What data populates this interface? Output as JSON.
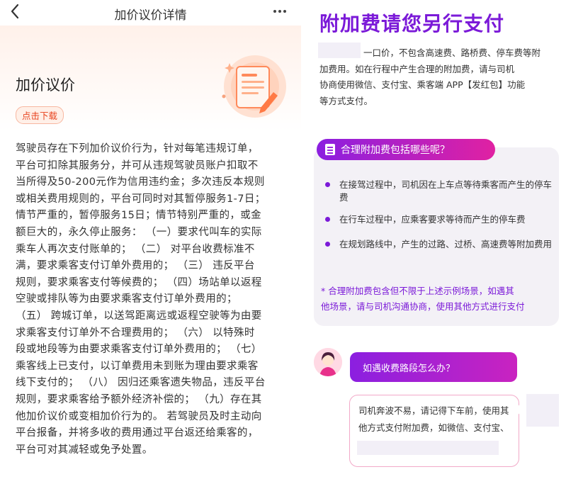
{
  "left": {
    "nav": {
      "back_icon": "chevron-left-icon",
      "title": "加价议价详情",
      "more_icon": "more-dots-icon"
    },
    "page_title": "加价议价",
    "download_label": "点击下载",
    "illustration_icon": "document-pen-icon",
    "rules_lines": [
      "驾驶员存在下列加价议价行为，针对每笔违规订单，",
      "平台可扣除其服务分，并可从违规驾驶员账户扣取不",
      "当所得及50-200元作为信用违约金；多次违反本规则",
      "或相关费用规则的，平台可同时对其暂停服务1-7日；",
      "情节严重的，暂停服务15日；情节特别严重的，或金",
      "额巨大的，永久停止服务：  （一）要求代叫车的实际",
      "乘车人再次支付账单的；  （二）  对平台收费标准不",
      "满，要求乘客支付订单外费用的；  （三）  违反平台",
      "规则，要求乘客支付等候费的；  （四）场站单以返程",
      "空驶或排队等为由要求乘客支付订单外费用的；",
      "（五）  跨城订单，以送驾距离远或返程空驶等为由要",
      "求乘客支付订单外不合理费用的；  （六）  以特殊时",
      "段或地段等为由要求乘客支付订单外费用的；  （七）",
      "乘客线上已支付，以订单费用未到账为理由要求乘客",
      "线下支付的；  （八）  因归还乘客遗失物品，违反平台",
      "规则，要求乘客给予额外经济补偿的；  （九）存在其",
      "他加价议价或变相加价行为的。  若驾驶员及时主动向",
      "平台报备，并将多收的费用通过平台返还给乘客的，",
      "平台可对其减轻或免予处置。"
    ]
  },
  "right": {
    "title": "附加费请您另行支付",
    "intro_lines": [
      "一口价，不包含高速费、路桥费、停车费等附",
      "加费用。如在行程中产生合理的附加费，请与司机",
      "协商使用微信、支付宝、乘客端 APP【发红包】功能",
      "等方式支付。"
    ],
    "card": {
      "tag_icon": "list-doc-icon",
      "tag_label": "合理附加费包括哪些呢？",
      "bullets": [
        "在接驾过程中，司机因在上车点等待乘客而产生的停车费",
        "在行车过程中，应乘客要求等待而产生的停车费",
        "在规划路线中，产生的过路、过桥、高速费等附加费用"
      ],
      "note_lines": [
        "* 合理附加费包含但不限于上述示例场景，如遇其",
        "他场景，请与司机沟通协商，使用其他方式进行支付"
      ]
    },
    "chat": {
      "avatar_icon": "user-avatar-icon",
      "question": "如遇收费路段怎么办？",
      "answer_lines": [
        "司机奔波不易，请记得下车前，使用其",
        "他方式支付附加费，如微信、支付宝、"
      ]
    },
    "colors": {
      "accent": "#7b1ad8",
      "gradient_end": "#e021a2",
      "orange": "#e8441f"
    }
  }
}
